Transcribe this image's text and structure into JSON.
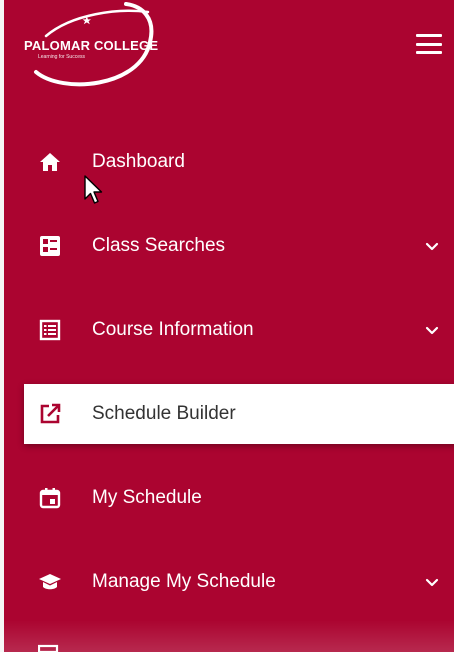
{
  "brand": {
    "name": "PALOMAR COLLEGE",
    "tagline": "Learning for Success",
    "primary_color": "#ab0430"
  },
  "header": {
    "menu_icon": "hamburger-menu-icon"
  },
  "nav": {
    "items": [
      {
        "label": "Dashboard",
        "icon": "home-icon",
        "expandable": false,
        "active": false
      },
      {
        "label": "Class Searches",
        "icon": "search-list-icon",
        "expandable": true,
        "active": false
      },
      {
        "label": "Course Information",
        "icon": "list-icon",
        "expandable": true,
        "active": false
      },
      {
        "label": "Schedule Builder",
        "icon": "external-link-icon",
        "expandable": false,
        "active": true
      },
      {
        "label": "My Schedule",
        "icon": "calendar-icon",
        "expandable": false,
        "active": false
      },
      {
        "label": "Manage My Schedule",
        "icon": "graduation-cap-icon",
        "expandable": true,
        "active": false
      }
    ]
  }
}
